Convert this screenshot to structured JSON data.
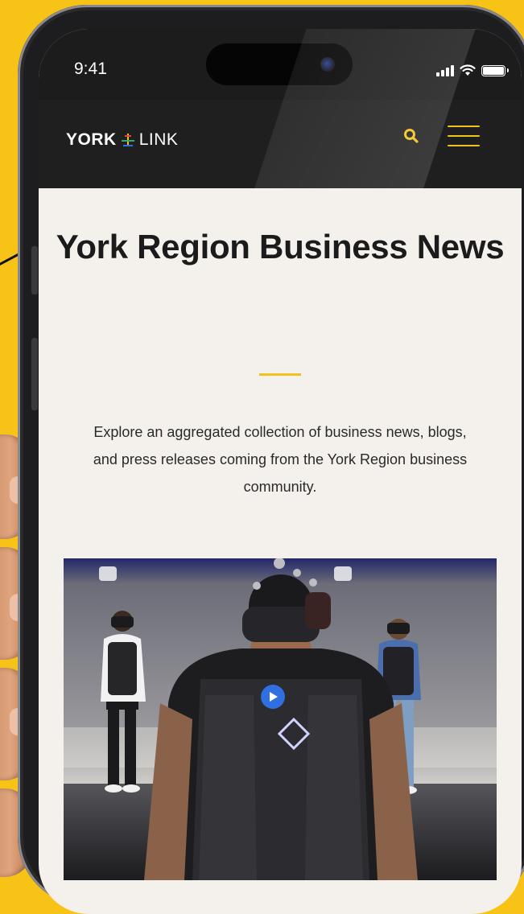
{
  "status_bar": {
    "time": "9:41"
  },
  "header": {
    "logo_part1": "YORK",
    "logo_part2": "LINK"
  },
  "page": {
    "title": "York Region Business News",
    "intro": "Explore an aggregated collection of business news, blogs, and press releases coming from the York Region business community."
  },
  "colors": {
    "background": "#f7c316",
    "accent": "#f2c21c",
    "navbar": "#1f1f1f",
    "page_bg": "#f4f1ec",
    "hero_play": "#2f6fe0"
  },
  "icons": [
    "search-icon",
    "menu-icon",
    "signal-icon",
    "wifi-icon",
    "battery-icon",
    "play-icon"
  ]
}
